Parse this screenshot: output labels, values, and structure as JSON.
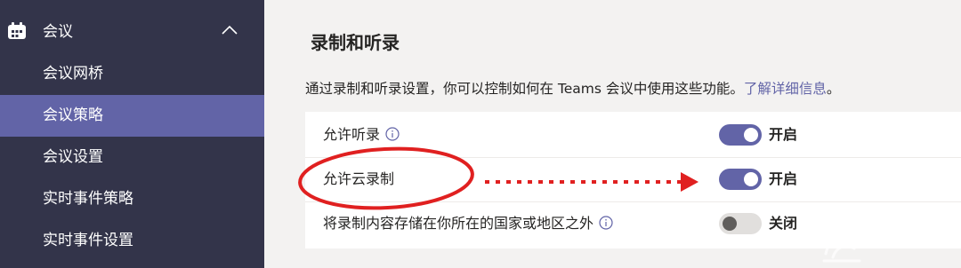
{
  "sidebar": {
    "group_label": "会议",
    "items": [
      {
        "label": "会议网桥",
        "active": false
      },
      {
        "label": "会议策略",
        "active": true
      },
      {
        "label": "会议设置",
        "active": false
      },
      {
        "label": "实时事件策略",
        "active": false
      },
      {
        "label": "实时事件设置",
        "active": false
      }
    ]
  },
  "main": {
    "title": "录制和听录",
    "description": "通过录制和听录设置，你可以控制如何在 Teams 会议中使用这些功能。",
    "learn_more_link": "了解详细信息",
    "description_end": "。",
    "settings": [
      {
        "label": "允许听录",
        "info_icon": true,
        "state": "on",
        "state_label": "开启"
      },
      {
        "label": "允许云录制",
        "info_icon": false,
        "state": "on",
        "state_label": "开启"
      },
      {
        "label": "将录制内容存储在你所在的国家或地区之外",
        "info_icon": true,
        "state": "off",
        "state_label": "关闭"
      }
    ]
  },
  "colors": {
    "sidebar_bg": "#33344a",
    "active_item": "#6264a7",
    "accent": "#6264a7",
    "annotation": "#e02020"
  }
}
